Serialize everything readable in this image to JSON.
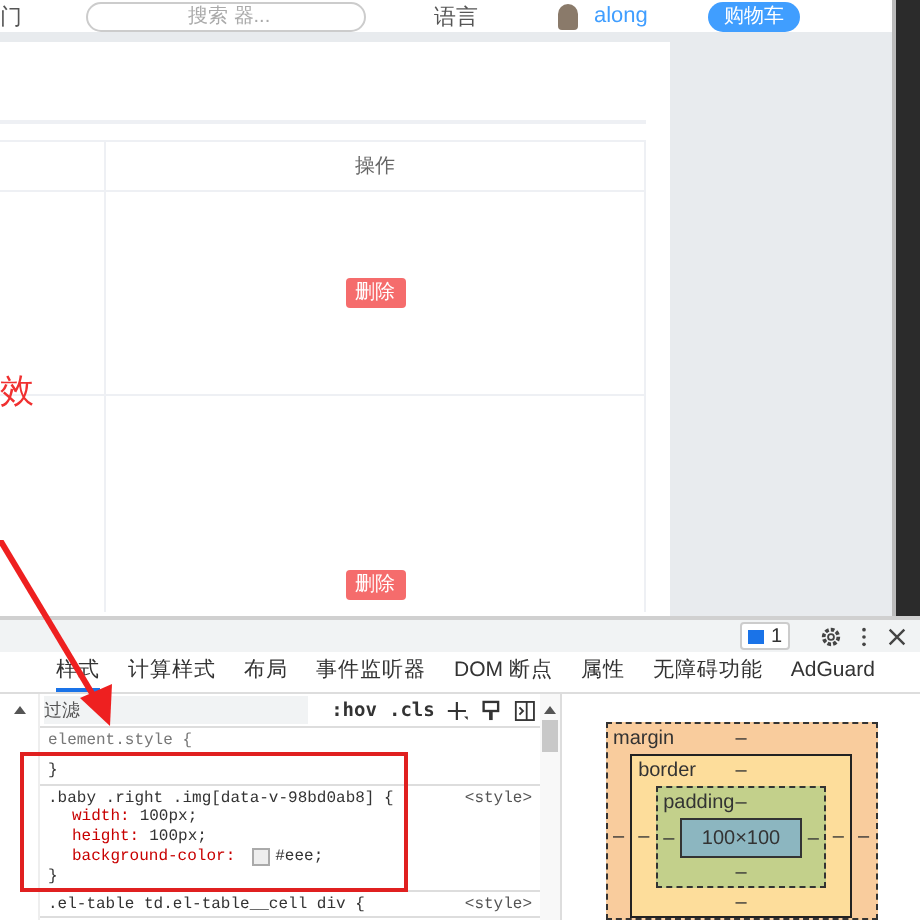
{
  "header": {
    "nav_item": "门",
    "search": {
      "placeholder": "搜索 器..."
    },
    "language": "语言",
    "user": "along",
    "cart_button": "购物车"
  },
  "table": {
    "columns": [
      "操作"
    ],
    "rows": [
      {
        "action": "删除"
      },
      {
        "action": "删除"
      }
    ]
  },
  "annotation": {
    "note": "效"
  },
  "devtools": {
    "issues_count": "1",
    "tabs": [
      {
        "label": "样式",
        "selected": true
      },
      {
        "label": "计算样式",
        "selected": false
      },
      {
        "label": "布局",
        "selected": false
      },
      {
        "label": "事件监听器",
        "selected": false
      },
      {
        "label": "DOM 断点",
        "selected": false
      },
      {
        "label": "属性",
        "selected": false
      },
      {
        "label": "无障碍功能",
        "selected": false
      },
      {
        "label": "AdGuard",
        "selected": false
      }
    ],
    "filter": {
      "placeholder": "过滤"
    },
    "toggles": [
      ":hov",
      ".cls"
    ],
    "rules": [
      {
        "selector": "element.style {",
        "close": "}"
      },
      {
        "selector": ".baby .right .img[data-v-98bd0ab8] {",
        "source": "<style>",
        "close": "}",
        "declarations": [
          {
            "property": "width:",
            "value": "100px;"
          },
          {
            "property": "height:",
            "value": "100px;"
          },
          {
            "property": "background-color:",
            "value": "#eee;",
            "color": "#eeeeee"
          }
        ]
      },
      {
        "selector": ".el-table td.el-table__cell div {",
        "source": "<style>"
      }
    ],
    "box_model": {
      "margin": {
        "label": "margin",
        "top": "–",
        "left": "–",
        "right": "–"
      },
      "border": {
        "label": "border",
        "top": "–",
        "left": "–",
        "right": "–",
        "bottom": "–"
      },
      "padding": {
        "label": "padding",
        "top": "–",
        "left": "–",
        "right": "–",
        "bottom": "–"
      },
      "content": "100×100"
    }
  }
}
